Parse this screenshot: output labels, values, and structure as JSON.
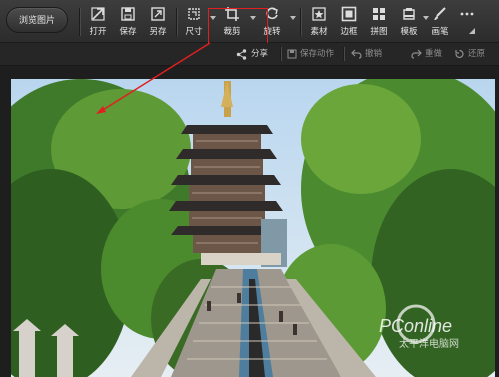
{
  "toolbar": {
    "browse_label": "浏览图片",
    "tools": [
      {
        "label": "打开",
        "icon": "open-icon"
      },
      {
        "label": "保存",
        "icon": "save-icon"
      },
      {
        "label": "另存",
        "icon": "save-as-icon"
      },
      {
        "label": "尺寸",
        "icon": "resize-icon"
      },
      {
        "label": "裁剪",
        "icon": "crop-icon"
      },
      {
        "label": "旋转",
        "icon": "rotate-icon"
      },
      {
        "label": "素材",
        "icon": "material-icon"
      },
      {
        "label": "边框",
        "icon": "frame-icon"
      },
      {
        "label": "拼图",
        "icon": "collage-icon"
      },
      {
        "label": "模板",
        "icon": "template-icon"
      },
      {
        "label": "画笔",
        "icon": "brush-icon"
      }
    ],
    "more_icon": "more-icon"
  },
  "subbar": {
    "share": "分享",
    "save_action": "保存动作",
    "undo": "撤销",
    "redo": "重做",
    "restore": "还原"
  },
  "watermark": {
    "brand": "PConline",
    "sub": "太平洋电脑网"
  },
  "colors": {
    "highlight": "#e02020",
    "toolbar": "#333333"
  }
}
